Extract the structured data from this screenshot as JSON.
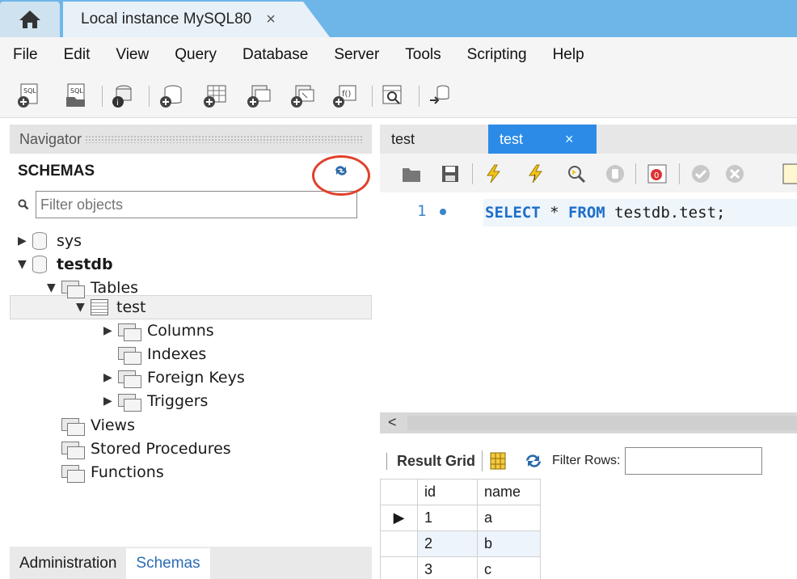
{
  "titlebar": {
    "connection_tab": "Local instance MySQL80",
    "close_glyph": "×"
  },
  "menu": [
    "File",
    "Edit",
    "View",
    "Query",
    "Database",
    "Server",
    "Tools",
    "Scripting",
    "Help"
  ],
  "navigator": {
    "header": "Navigator",
    "schemas_label": "SCHEMAS",
    "filter_placeholder": "Filter objects",
    "tree": {
      "sys": "sys",
      "testdb": "testdb",
      "tables": "Tables",
      "test": "test",
      "columns": "Columns",
      "indexes": "Indexes",
      "foreign_keys": "Foreign Keys",
      "triggers": "Triggers",
      "views": "Views",
      "stored_procedures": "Stored Procedures",
      "functions": "Functions"
    },
    "bottom_tabs": [
      "Administration",
      "Schemas"
    ]
  },
  "editor": {
    "tabs": [
      "test",
      "test"
    ],
    "line_number": "1",
    "code": {
      "kw1": "SELECT",
      "mid": " * ",
      "kw2": "FROM",
      "rest": " testdb.test;"
    }
  },
  "results": {
    "grid_label": "Result Grid",
    "filter_label": "Filter Rows:",
    "columns": [
      "id",
      "name"
    ],
    "rows": [
      [
        "1",
        "a"
      ],
      [
        "2",
        "b"
      ],
      [
        "3",
        "c"
      ]
    ]
  },
  "colors": {
    "accent_tab": "#2d8be8",
    "highlight_circle": "#e0412b",
    "titlebar": "#6fb6e8"
  }
}
